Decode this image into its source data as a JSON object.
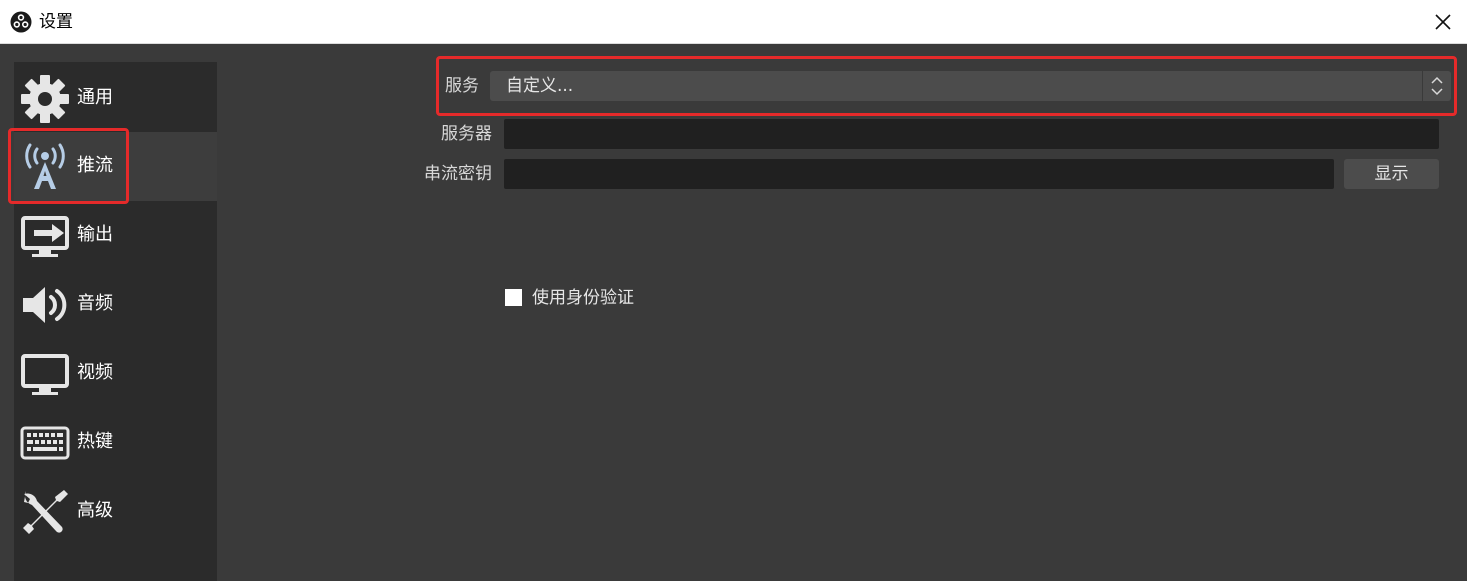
{
  "window": {
    "title": "设置",
    "app_icon": "obs-logo-icon",
    "close_icon": "close-icon"
  },
  "sidebar": {
    "items": [
      {
        "label": "通用",
        "icon": "gear-icon"
      },
      {
        "label": "推流",
        "icon": "broadcast-antenna-icon",
        "selected": true
      },
      {
        "label": "输出",
        "icon": "monitor-output-icon"
      },
      {
        "label": "音频",
        "icon": "speaker-icon"
      },
      {
        "label": "视频",
        "icon": "monitor-icon"
      },
      {
        "label": "热键",
        "icon": "keyboard-icon"
      },
      {
        "label": "高级",
        "icon": "wrench-screwdriver-icon"
      }
    ]
  },
  "stream": {
    "service_label": "服务",
    "service_value": "自定义...",
    "server_label": "服务器",
    "server_value": "",
    "key_label": "串流密钥",
    "key_value": "",
    "show_button": "显示",
    "auth_checkbox_label": "使用身份验证",
    "auth_checked": false
  },
  "colors": {
    "highlight": "#e52a2a",
    "background": "#3a3a3a",
    "sidebar": "#2b2b2b",
    "selected_item": "#3d3d3d",
    "input": "#202020",
    "control": "#4c4c4c"
  }
}
